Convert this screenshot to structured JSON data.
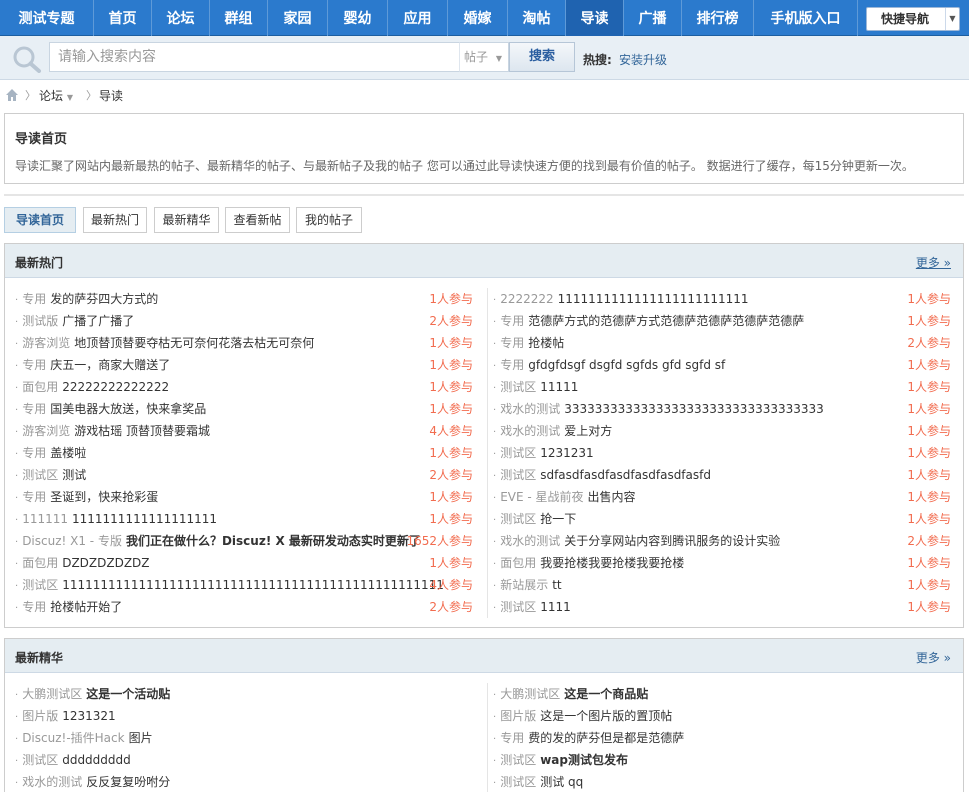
{
  "nav": {
    "items": [
      {
        "label": "测试专题"
      },
      {
        "label": "首页"
      },
      {
        "label": "论坛"
      },
      {
        "label": "群组"
      },
      {
        "label": "家园"
      },
      {
        "label": "婴幼"
      },
      {
        "label": "应用"
      },
      {
        "label": "婚嫁"
      },
      {
        "label": "淘帖"
      },
      {
        "label": "导读",
        "active": true
      },
      {
        "label": "广播"
      },
      {
        "label": "排行榜"
      },
      {
        "label": "手机版入口"
      }
    ],
    "quick_nav": "快捷导航"
  },
  "search": {
    "placeholder": "请输入搜索内容",
    "type_label": "帖子",
    "button_label": "搜索",
    "hot_label": "热搜:",
    "hot_link": "安装升级"
  },
  "breadcrumb": {
    "forum": "论坛",
    "current": "导读"
  },
  "intro": {
    "title": "导读首页",
    "description": "导读汇聚了网站内最新最热的帖子、最新精华的帖子、与最新帖子及我的帖子 您可以通过此导读快速方便的找到最有价值的帖子。 数据进行了缓存，每15分钟更新一次。"
  },
  "tabs": [
    {
      "label": "导读首页",
      "active": true
    },
    {
      "label": "最新热门"
    },
    {
      "label": "最新精华"
    },
    {
      "label": "查看新帖"
    },
    {
      "label": "我的帖子"
    }
  ],
  "hot": {
    "title": "最新热门",
    "more": "更多 »",
    "left": [
      {
        "forum": "专用",
        "title": "发的萨芬四大方式的",
        "count": "1人参与"
      },
      {
        "forum": "测试版",
        "title": "广播了广播了",
        "count": "2人参与"
      },
      {
        "forum": "游客浏览",
        "title": "地顶替顶替要夺枯无可奈何花落去枯无可奈何",
        "count": "1人参与"
      },
      {
        "forum": "专用",
        "title": "庆五一，商家大赠送了",
        "count": "1人参与"
      },
      {
        "forum": "面包用",
        "title": "22222222222222",
        "count": "1人参与"
      },
      {
        "forum": "专用",
        "title": "国美电器大放送，快来拿奖品",
        "count": "1人参与"
      },
      {
        "forum": "游客浏览",
        "title": "游戏枯瑶 顶替顶替要霜城",
        "count": "4人参与"
      },
      {
        "forum": "专用",
        "title": "盖楼啦",
        "count": "1人参与"
      },
      {
        "forum": "测试区",
        "title": "测试",
        "count": "2人参与"
      },
      {
        "forum": "专用",
        "title": "圣诞到，快来抢彩蛋",
        "count": "1人参与"
      },
      {
        "forum": "111111",
        "title": "1111111111111111111",
        "count": "1人参与"
      },
      {
        "forum": "Discuz! X1 - 专版",
        "title": "我们正在做什么？Discuz! X 最新研发动态实时更新了",
        "count": "1652人参与",
        "bold": true
      },
      {
        "forum": "面包用",
        "title": "DZDZDZDZDZ",
        "count": "1人参与"
      },
      {
        "forum": "测试区",
        "title": "11111111111111111111111111111111111111111111111111",
        "count": "4人参与"
      },
      {
        "forum": "专用",
        "title": "抢楼帖开始了",
        "count": "2人参与"
      }
    ],
    "right": [
      {
        "forum": "2222222",
        "title": "1111111111111111111111111",
        "count": "1人参与"
      },
      {
        "forum": "专用",
        "title": "范德萨方式的范德萨方式范德萨范德萨范德萨范德萨",
        "count": "1人参与"
      },
      {
        "forum": "专用",
        "title": "抢楼帖",
        "count": "2人参与"
      },
      {
        "forum": "专用",
        "title": "gfdgfdsgf dsgfd sgfds gfd sgfd sf",
        "count": "1人参与"
      },
      {
        "forum": "测试区",
        "title": "11111",
        "count": "1人参与"
      },
      {
        "forum": "戏水的测试",
        "title": "3333333333333333333333333333333333",
        "count": "1人参与"
      },
      {
        "forum": "戏水的测试",
        "title": "爱上对方",
        "count": "1人参与"
      },
      {
        "forum": "测试区",
        "title": "1231231",
        "count": "1人参与"
      },
      {
        "forum": "测试区",
        "title": "sdfasdfasdfasdfasdfasdfasfd",
        "count": "1人参与"
      },
      {
        "forum": "EVE - 星战前夜",
        "title": "出售内容",
        "count": "1人参与"
      },
      {
        "forum": "测试区",
        "title": "抢一下",
        "count": "1人参与"
      },
      {
        "forum": "戏水的测试",
        "title": "关于分享网站内容到腾讯服务的设计实验",
        "count": "2人参与"
      },
      {
        "forum": "面包用",
        "title": "我要抢楼我要抢楼我要抢楼",
        "count": "1人参与"
      },
      {
        "forum": "新站展示",
        "title": "tt",
        "count": "1人参与"
      },
      {
        "forum": "测试区",
        "title": "1111",
        "count": "1人参与"
      }
    ]
  },
  "digest": {
    "title": "最新精华",
    "more": "更多 »",
    "left": [
      {
        "forum": "大鹏测试区",
        "title": "这是一个活动贴",
        "bold": true
      },
      {
        "forum": "图片版",
        "title": "1231321"
      },
      {
        "forum": "Discuz!-插件Hack",
        "title": "图片"
      },
      {
        "forum": "测试区",
        "title": "ddddddddd"
      },
      {
        "forum": "戏水的测试",
        "title": "反反复复吩咐分"
      }
    ],
    "right": [
      {
        "forum": "大鹏测试区",
        "title": "这是一个商品贴",
        "bold": true
      },
      {
        "forum": "图片版",
        "title": "这是一个图片版的置顶帖"
      },
      {
        "forum": "专用",
        "title": "费的发的萨芬但是都是范德萨"
      },
      {
        "forum": "测试区",
        "title": "wap测试包发布",
        "bold": true
      },
      {
        "forum": "测试区",
        "title": "测试 qq"
      }
    ]
  }
}
